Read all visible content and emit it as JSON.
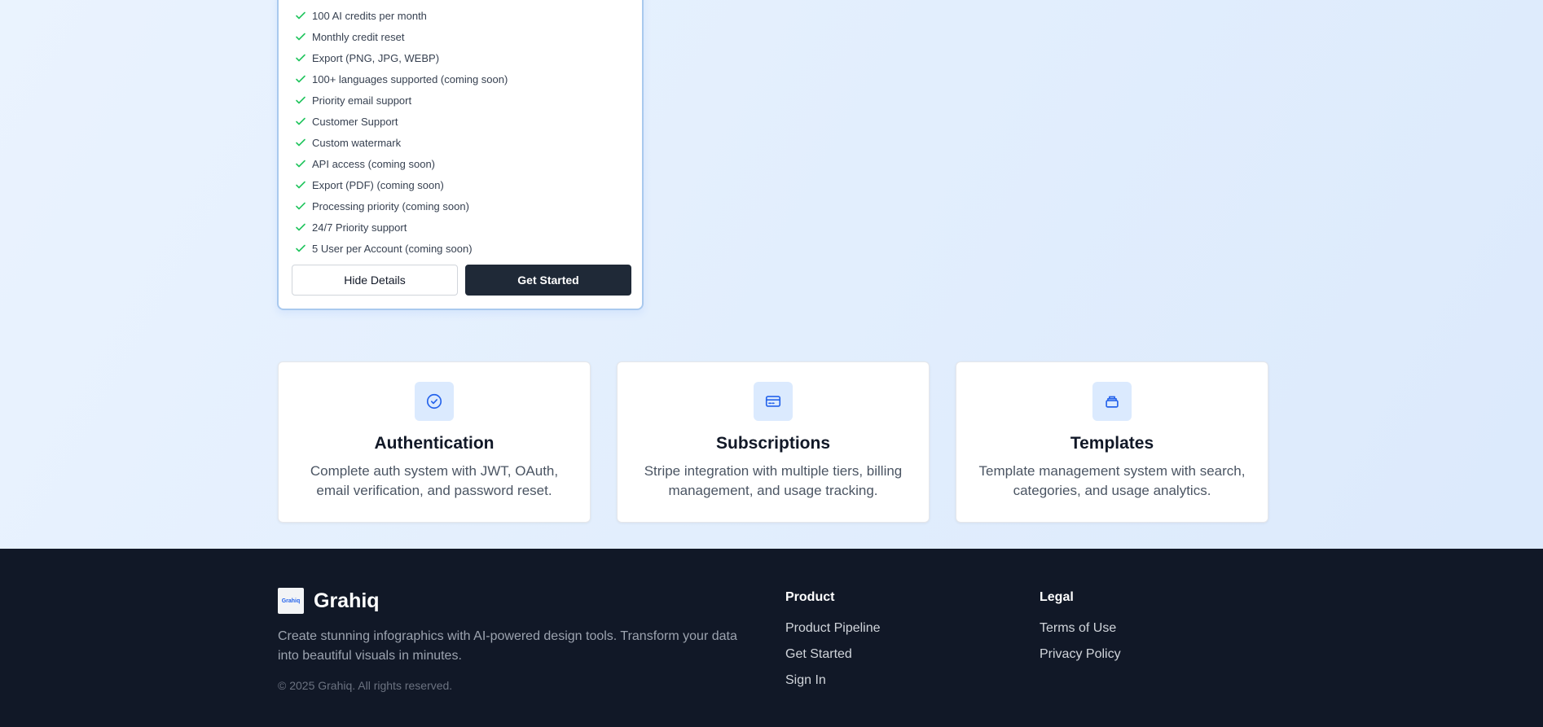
{
  "pricing": {
    "features": [
      "100 AI credits per month",
      "Monthly credit reset",
      "Export (PNG, JPG, WEBP)",
      "100+ languages supported (coming soon)",
      "Priority email support",
      "Customer Support",
      "Custom watermark",
      "API access (coming soon)",
      "Export (PDF) (coming soon)",
      "Processing priority (coming soon)",
      "24/7 Priority support",
      "5 User per Account (coming soon)"
    ],
    "hide_details_label": "Hide Details",
    "get_started_label": "Get Started",
    "check_color": "#22c55e"
  },
  "cards": [
    {
      "icon": "check-circle-icon",
      "title": "Authentication",
      "description": "Complete auth system with JWT, OAuth, email verification, and password reset."
    },
    {
      "icon": "credit-card-icon",
      "title": "Subscriptions",
      "description": "Stripe integration with multiple tiers, billing management, and usage tracking."
    },
    {
      "icon": "layers-icon",
      "title": "Templates",
      "description": "Template management system with search, categories, and usage analytics."
    }
  ],
  "footer": {
    "logo_text": "Grahiq",
    "brand_name": "Grahiq",
    "description": "Create stunning infographics with AI-powered design tools. Transform your data into beautiful visuals in minutes.",
    "copyright": "© 2025 Grahiq. All rights reserved.",
    "product": {
      "heading": "Product",
      "links": [
        "Product Pipeline",
        "Get Started",
        "Sign In"
      ]
    },
    "legal": {
      "heading": "Legal",
      "links": [
        "Terms of Use",
        "Privacy Policy"
      ]
    }
  },
  "colors": {
    "accent": "#2563eb",
    "dark": "#1f2937",
    "footer_bg": "#111827"
  }
}
